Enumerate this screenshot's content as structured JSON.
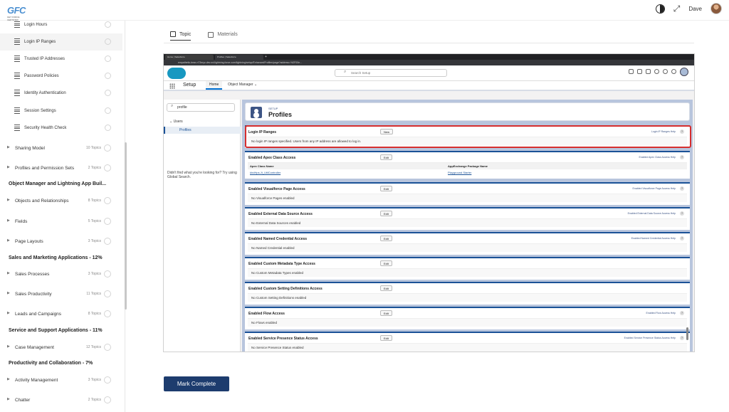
{
  "app": {
    "logo_text": "GFC",
    "logo_sub": "GET FORCE CERTIFIED",
    "user_name": "Dave"
  },
  "sidebar": {
    "sub_items": [
      {
        "label": "Login Hours"
      },
      {
        "label": "Login IP Ranges"
      },
      {
        "label": "Trusted IP Addresses"
      },
      {
        "label": "Password Policies"
      },
      {
        "label": "Identity Authentication"
      },
      {
        "label": "Session Settings"
      },
      {
        "label": "Security Health Check"
      }
    ],
    "topics": [
      {
        "label": "Sharing Model",
        "count": "10 Topics"
      },
      {
        "label": "Profiles and Permission Sets",
        "count": "2 Topics"
      },
      {
        "label": "Objects and Relationships",
        "count": "8 Topics"
      },
      {
        "label": "Fields",
        "count": "5 Topics"
      },
      {
        "label": "Page Layouts",
        "count": "3 Topics"
      },
      {
        "label": "Sales Processes",
        "count": "3 Topics"
      },
      {
        "label": "Sales Productivity",
        "count": "11 Topics"
      },
      {
        "label": "Leads and Campaigns",
        "count": "8 Topics"
      },
      {
        "label": "Case Management",
        "count": "12 Topics"
      },
      {
        "label": "Activity Management",
        "count": "3 Topics"
      },
      {
        "label": "Chatter",
        "count": "2 Topics"
      }
    ],
    "sections": [
      "Object Manager and Lightning App Buil...",
      "Sales and Marketing Applications - 12%",
      "Service and Support Applications - 11%",
      "Productivity and Collaboration - 7%"
    ]
  },
  "tabs": {
    "topic": "Topic",
    "materials": "Materials"
  },
  "screenshot": {
    "browser_tabs": [
      "Home | Salesforce",
      "Profiles | Salesforce"
    ],
    "url": "empathetic-bear-n73myz-dev-ed.lightning.force.com/lightning/setup/EnhancedProfiles/page?address=%2F00e...",
    "search_placeholder": "Search Setup",
    "setup_label": "Setup",
    "nav_home": "Home",
    "nav_object_manager": "Object Manager",
    "quick_find_value": "profile",
    "users_label": "Users",
    "profiles_item": "Profiles",
    "didnt_find": "Didn't find what you're looking for? Try using Global Search.",
    "setup_small": "SETUP",
    "page_title": "Profiles",
    "sections": [
      {
        "title": "Login IP Ranges",
        "button": "New",
        "help": "Login IP Ranges Help",
        "body": "No login IP ranges specified. Users from any IP address are allowed to log in."
      },
      {
        "title": "Enabled Apex Class Access",
        "button": "Edit",
        "help": "Enabled Apex Class Access Help",
        "col1": "Apex Class Name",
        "col2": "AppExchange Package Name",
        "val1": "khdHps.Jt_UtilController",
        "val2": "Playground Starter"
      },
      {
        "title": "Enabled Visualforce Page Access",
        "button": "Edit",
        "help": "Enabled Visualforce Page Access Help",
        "body": "No Visualforce Pages enabled"
      },
      {
        "title": "Enabled External Data Source Access",
        "button": "Edit",
        "help": "Enabled External Data Source Access Help",
        "body": "No External Data Sources enabled"
      },
      {
        "title": "Enabled Named Credential Access",
        "button": "Edit",
        "help": "Enabled Named Credential Access Help",
        "body": "No Named Credential enabled"
      },
      {
        "title": "Enabled Custom Metadata Type Access",
        "button": "Edit",
        "help": "",
        "body": "No Custom Metadata Types enabled"
      },
      {
        "title": "Enabled Custom Setting Definitions Access",
        "button": "Edit",
        "help": "",
        "body": "No Custom Setting Definitions enabled"
      },
      {
        "title": "Enabled Flow Access",
        "button": "Edit",
        "help": "Enabled Flow Access Help",
        "body": "No Flows enabled"
      },
      {
        "title": "Enabled Service Presence Status Access",
        "button": "Edit",
        "help": "Enabled Service Presence Status Access Help",
        "body": "No Service Presence Status enabled"
      }
    ]
  },
  "mark_complete": "Mark Complete",
  "colors": {
    "accent": "#1d3c6e",
    "highlight": "#d62e2e",
    "sf_blue": "#1b5297"
  }
}
